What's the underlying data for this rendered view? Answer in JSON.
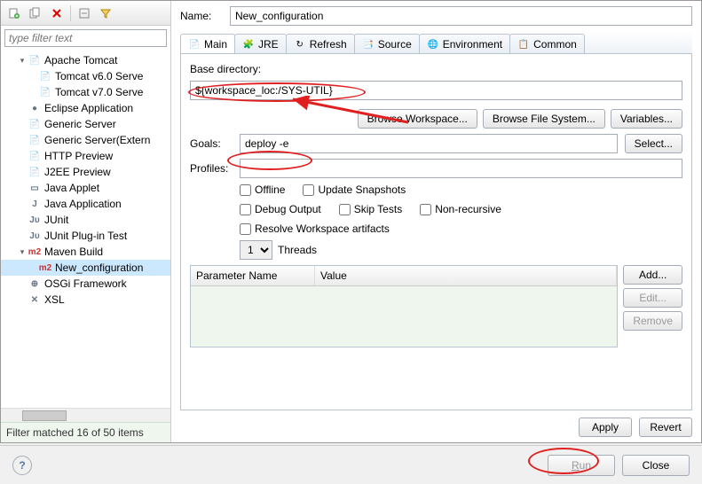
{
  "name_label": "Name:",
  "name_value": "New_configuration",
  "filter_placeholder": "type filter text",
  "filter_status": "Filter matched 16 of 50 items",
  "tree": [
    {
      "label": "Apache Tomcat",
      "icon": "📄",
      "expand": "▾",
      "indent": 1
    },
    {
      "label": "Tomcat v6.0 Serve",
      "icon": "📄",
      "expand": "",
      "indent": 2
    },
    {
      "label": "Tomcat v7.0 Serve",
      "icon": "📄",
      "expand": "",
      "indent": 2
    },
    {
      "label": "Eclipse Application",
      "icon": "●",
      "expand": "",
      "indent": 1
    },
    {
      "label": "Generic Server",
      "icon": "📄",
      "expand": "",
      "indent": 1
    },
    {
      "label": "Generic Server(Extern",
      "icon": "📄",
      "expand": "",
      "indent": 1
    },
    {
      "label": "HTTP Preview",
      "icon": "📄",
      "expand": "",
      "indent": 1
    },
    {
      "label": "J2EE Preview",
      "icon": "📄",
      "expand": "",
      "indent": 1
    },
    {
      "label": "Java Applet",
      "icon": "▭",
      "expand": "",
      "indent": 1
    },
    {
      "label": "Java Application",
      "icon": "J",
      "expand": "",
      "indent": 1
    },
    {
      "label": "JUnit",
      "icon": "Jᴜ",
      "expand": "",
      "indent": 1
    },
    {
      "label": "JUnit Plug-in Test",
      "icon": "Jᴜ",
      "expand": "",
      "indent": 1
    },
    {
      "label": "Maven Build",
      "icon": "m2",
      "expand": "▾",
      "indent": 1
    },
    {
      "label": "New_configuration",
      "icon": "m2",
      "expand": "",
      "indent": 2,
      "selected": true
    },
    {
      "label": "OSGi Framework",
      "icon": "⊕",
      "expand": "",
      "indent": 1
    },
    {
      "label": "XSL",
      "icon": "✕",
      "expand": "",
      "indent": 1
    }
  ],
  "tabs": [
    {
      "label": "Main",
      "icon": "📄",
      "active": true
    },
    {
      "label": "JRE",
      "icon": "🧩"
    },
    {
      "label": "Refresh",
      "icon": "↻"
    },
    {
      "label": "Source",
      "icon": "📑"
    },
    {
      "label": "Environment",
      "icon": "🌐"
    },
    {
      "label": "Common",
      "icon": "📋"
    }
  ],
  "base_dir_label": "Base directory:",
  "base_dir_value": "${workspace_loc:/SYS-UTIL}",
  "browse_ws": "Browse Workspace...",
  "browse_fs": "Browse File System...",
  "variables": "Variables...",
  "goals_label": "Goals:",
  "goals_value": "deploy -e",
  "select_btn": "Select...",
  "profiles_label": "Profiles:",
  "profiles_value": "",
  "checks": {
    "offline": "Offline",
    "update": "Update Snapshots",
    "debug": "Debug Output",
    "skip": "Skip Tests",
    "nonrec": "Non-recursive",
    "resolve": "Resolve Workspace artifacts"
  },
  "threads_value": "1",
  "threads_label": "Threads",
  "param_headers": {
    "name": "Parameter Name",
    "value": "Value"
  },
  "param_btns": {
    "add": "Add...",
    "edit": "Edit...",
    "remove": "Remove"
  },
  "apply": "Apply",
  "revert": "Revert",
  "run": "Run",
  "close": "Close"
}
